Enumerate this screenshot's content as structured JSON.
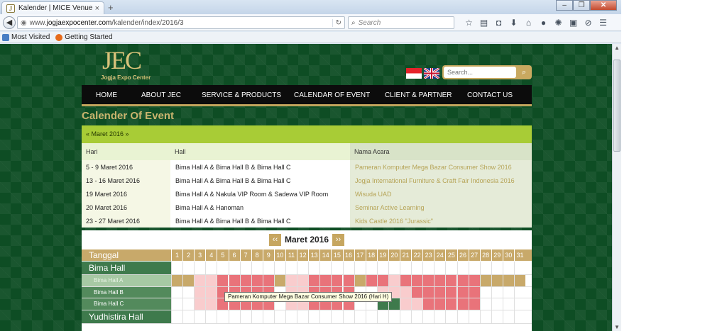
{
  "browser": {
    "tab_title": "Kalender | MICE Venue",
    "tab_close": "×",
    "new_tab": "+",
    "url_prefix": "www.",
    "url_domain": "jogjaexpocenter.com",
    "url_path": "/kalender/index/2016/3",
    "search_placeholder": "Search",
    "bookmarks": [
      "Most Visited",
      "Getting Started"
    ],
    "tool_icons": [
      "star-icon",
      "reading-list-icon",
      "pocket-icon",
      "download-icon",
      "home-icon",
      "chat-icon",
      "addon-icon",
      "toolbar-icon",
      "sync-icon",
      "menu-icon"
    ]
  },
  "site": {
    "logo_mark": "JEC",
    "logo_sub": "Jogja Expo Center",
    "search_placeholder": "Search...",
    "nav": [
      "HOME",
      "ABOUT JEC",
      "SERVICE & PRODUCTS",
      "CALENDAR OF EVENT",
      "CLIENT & PARTNER",
      "CONTACT US"
    ],
    "page_title": "Calender Of Event",
    "month_nav": "« Maret 2016 »"
  },
  "events": {
    "headers": [
      "Hari",
      "Hall",
      "Nama Acara"
    ],
    "rows": [
      {
        "date": "5 - 9 Maret 2016",
        "hall": "Bima Hall A & Bima Hall B & Bima Hall C",
        "name": "Pameran Komputer Mega Bazar Consumer Show 2016"
      },
      {
        "date": "13 - 16 Maret 2016",
        "hall": "Bima Hall A & Bima Hall B & Bima Hall C",
        "name": "Jogja International Furniture & Craft Fair Indonesia 2016"
      },
      {
        "date": "19 Maret 2016",
        "hall": "Bima Hall A & Nakula VIP Room & Sadewa VIP Room",
        "name": "Wisuda UAD"
      },
      {
        "date": "20 Maret 2016",
        "hall": "Bima Hall A & Hanoman",
        "name": "Seminar Active Learning"
      },
      {
        "date": "23 - 27 Maret 2016",
        "hall": "Bima Hall A & Bima Hall B & Bima Hall C",
        "name": "Kids Castle 2016 \"Jurassic\""
      }
    ]
  },
  "calendar": {
    "month_label": "Maret 2016",
    "prev": "‹‹",
    "next": "››",
    "header_label": "Tanggal",
    "days": [
      "1",
      "2",
      "3",
      "4",
      "5",
      "6",
      "7",
      "8",
      "9",
      "10",
      "11",
      "12",
      "13",
      "14",
      "15",
      "16",
      "17",
      "18",
      "19",
      "20",
      "21",
      "22",
      "23",
      "24",
      "25",
      "26",
      "27",
      "28",
      "29",
      "30",
      "31"
    ],
    "rows": [
      {
        "label": "Bima Hall",
        "type": "group",
        "cells": "nnnnnnnnnnnnnnnnnnnnnnnnnnnnnnn"
      },
      {
        "label": "Bima Hall A",
        "type": "sub",
        "selected": true,
        "cells": "ggpprrrrrgpprrrrgrrprrrrrrrgggg"
      },
      {
        "label": "Bima Hall B",
        "type": "sub",
        "selected": false,
        "cells": "nnpprrrrrnpprrrrnnppprrrrrrnnnn"
      },
      {
        "label": "Bima Hall C",
        "type": "sub",
        "selected": false,
        "cells": "nnpprrrrrnpprrrrnnddpprrrrrnnnn"
      },
      {
        "label": "Yudhistira Hall",
        "type": "group",
        "cells": "nnnnnnnnnnnnnnnnnnnnnnnnnnnnnnn"
      }
    ],
    "tooltip": "Pameran Komputer Mega Bazar Consumer Show 2016 (Hari H)"
  },
  "colors": {
    "booked": "#e9737a",
    "setup": "#f9cccd",
    "gold": "#c8a96a",
    "dark_green": "#3e7a4c",
    "empty": "#ffffff"
  }
}
